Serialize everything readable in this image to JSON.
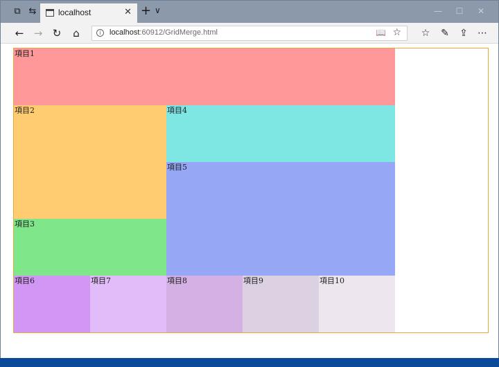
{
  "window": {
    "tab_title": "localhost",
    "new_tab_glyph": "+",
    "tab_list_glyph": "∨",
    "close_tab_glyph": "✕"
  },
  "address_bar": {
    "url_host": "localhost",
    "url_rest": ":60912/GridMerge.html"
  },
  "grid": {
    "items": [
      {
        "label": "項目1",
        "color": "#ff9999"
      },
      {
        "label": "項目2",
        "color": "#ffcc71"
      },
      {
        "label": "項目3",
        "color": "#80e68a"
      },
      {
        "label": "項目4",
        "color": "#7ee6e3"
      },
      {
        "label": "項目5",
        "color": "#96a8f5"
      },
      {
        "label": "項目6",
        "color": "#d297f5"
      },
      {
        "label": "項目7",
        "color": "#e2bcf8"
      },
      {
        "label": "項目8",
        "color": "#d3b1e5"
      },
      {
        "label": "項目9",
        "color": "#dcd0e3"
      },
      {
        "label": "項目10",
        "color": "#ede6ee"
      }
    ],
    "border_color": "#f2a33a"
  },
  "colors": {
    "titlebar": "#8c99ab",
    "toolbar": "#f2f2f2",
    "desktop": "#0b4a9a"
  },
  "icons": {
    "set_aside": "tabs-aside-icon",
    "show_aside": "show-tabs-icon",
    "back": "back-arrow-icon",
    "forward": "forward-arrow-icon",
    "refresh": "refresh-icon",
    "home": "home-icon",
    "favorites": "favorites-list-icon",
    "pen": "pen-icon",
    "share": "share-icon",
    "more": "more-icon"
  }
}
